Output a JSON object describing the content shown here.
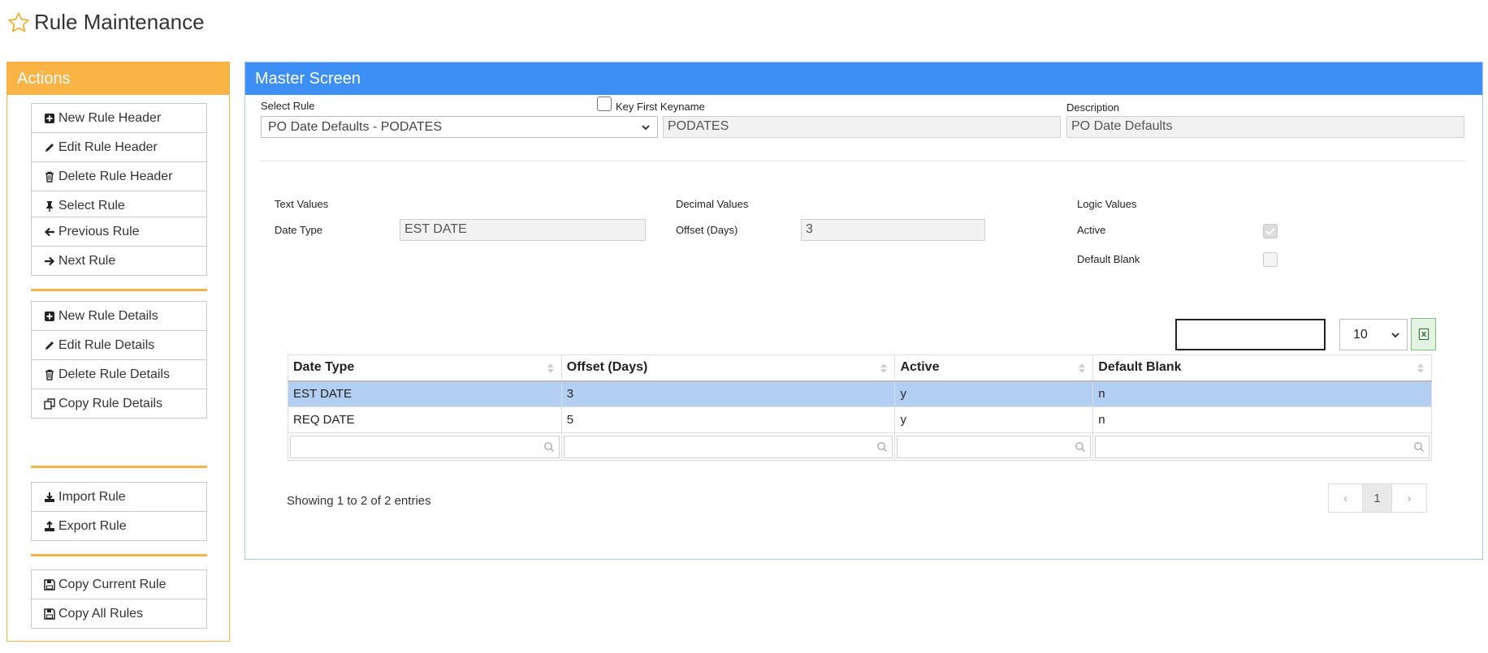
{
  "page": {
    "title": "Rule Maintenance"
  },
  "actions": {
    "title": "Actions",
    "group1": [
      {
        "label": "New Rule Header",
        "icon": "plus-square-icon"
      },
      {
        "label": "Edit Rule Header",
        "icon": "pencil-icon"
      },
      {
        "label": "Delete Rule Header",
        "icon": "trash-icon"
      },
      {
        "label": "Select Rule",
        "icon": "pin-icon"
      }
    ],
    "group2": [
      {
        "label": "Previous Rule",
        "icon": "arrow-left-icon"
      },
      {
        "label": "Next Rule",
        "icon": "arrow-right-icon"
      }
    ],
    "group3": [
      {
        "label": "New Rule Details",
        "icon": "plus-square-icon"
      },
      {
        "label": "Edit Rule Details",
        "icon": "pencil-icon"
      },
      {
        "label": "Delete Rule Details",
        "icon": "trash-icon"
      },
      {
        "label": "Copy Rule Details",
        "icon": "copy-icon"
      }
    ],
    "group4": [
      {
        "label": "Import Rule",
        "icon": "download-icon"
      },
      {
        "label": "Export Rule",
        "icon": "upload-icon"
      }
    ],
    "group5": [
      {
        "label": "Copy Current Rule",
        "icon": "save-icon"
      },
      {
        "label": "Copy All Rules",
        "icon": "save-icon"
      }
    ],
    "accent_color": "#f9b445"
  },
  "master": {
    "title": "Master Screen",
    "accent_color": "#3d8ef5",
    "select_rule": {
      "label": "Select Rule",
      "value": "PO Date Defaults - PODATES"
    },
    "key_first": {
      "label": "Key First Keyname",
      "checked": false,
      "value": "PODATES"
    },
    "description": {
      "label": "Description",
      "value": "PO Date Defaults"
    },
    "text_values": {
      "heading": "Text Values",
      "field_label": "Date Type",
      "field_value": "EST DATE"
    },
    "decimal_values": {
      "heading": "Decimal Values",
      "field_label": "Offset (Days)",
      "field_value": "3"
    },
    "logic_values": {
      "heading": "Logic Values",
      "active_label": "Active",
      "active_checked": true,
      "default_blank_label": "Default Blank",
      "default_blank_checked": false
    }
  },
  "table": {
    "search_value": "",
    "page_length": "10",
    "columns": [
      "Date Type",
      "Offset (Days)",
      "Active",
      "Default Blank"
    ],
    "rows": [
      [
        "EST DATE",
        "3",
        "y",
        "n"
      ],
      [
        "REQ DATE",
        "5",
        "y",
        "n"
      ]
    ],
    "selected_row": 0,
    "info": "Showing 1 to 2 of 2 entries",
    "pagination": {
      "prev": "‹",
      "current": "1",
      "next": "›"
    }
  }
}
